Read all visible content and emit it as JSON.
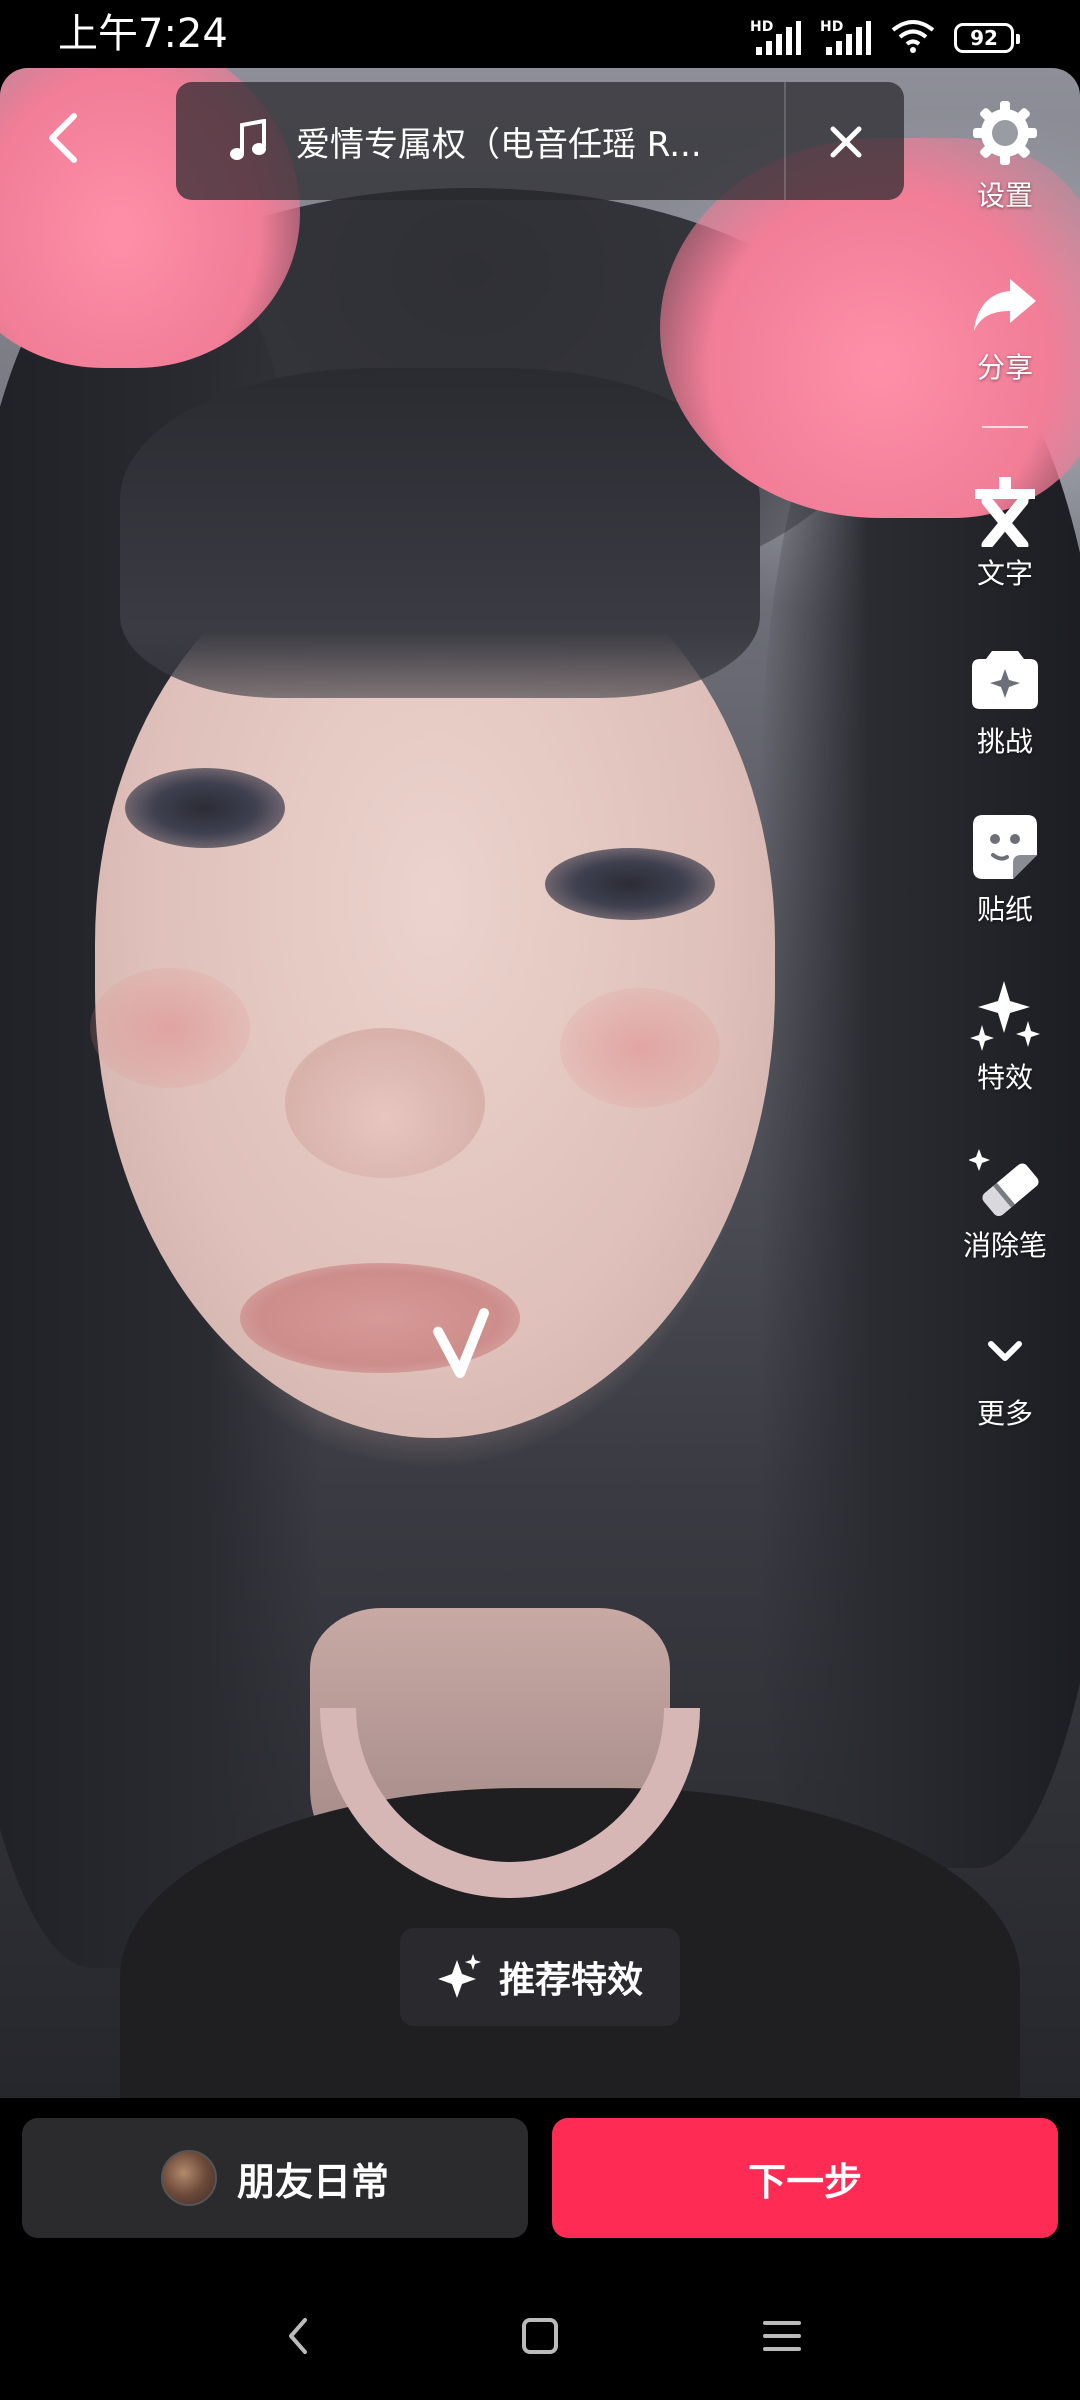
{
  "status_bar": {
    "time": "上午7:24",
    "signal1_label": "HD",
    "signal2_label": "HD",
    "battery": "92"
  },
  "music": {
    "title": "爱情专属权（电音任瑶 R..."
  },
  "toolbar": {
    "items": [
      {
        "label": "设置",
        "icon": "gear-icon"
      },
      {
        "label": "分享",
        "icon": "share-arrow-icon"
      },
      {
        "label": "文字",
        "icon": "text-icon"
      },
      {
        "label": "挑战",
        "icon": "challenge-icon"
      },
      {
        "label": "贴纸",
        "icon": "sticker-icon"
      },
      {
        "label": "特效",
        "icon": "sparkles-icon"
      },
      {
        "label": "消除笔",
        "icon": "eraser-pen-icon"
      },
      {
        "label": "更多",
        "icon": "chevron-down-icon"
      }
    ]
  },
  "recommend": {
    "label": "推荐特效"
  },
  "bottom": {
    "friends_label": "朋友日常",
    "next_label": "下一步"
  },
  "colors": {
    "accent": "#fe2c55",
    "button_dark": "#2b2b2e",
    "ear_pink": "#f17d97"
  }
}
